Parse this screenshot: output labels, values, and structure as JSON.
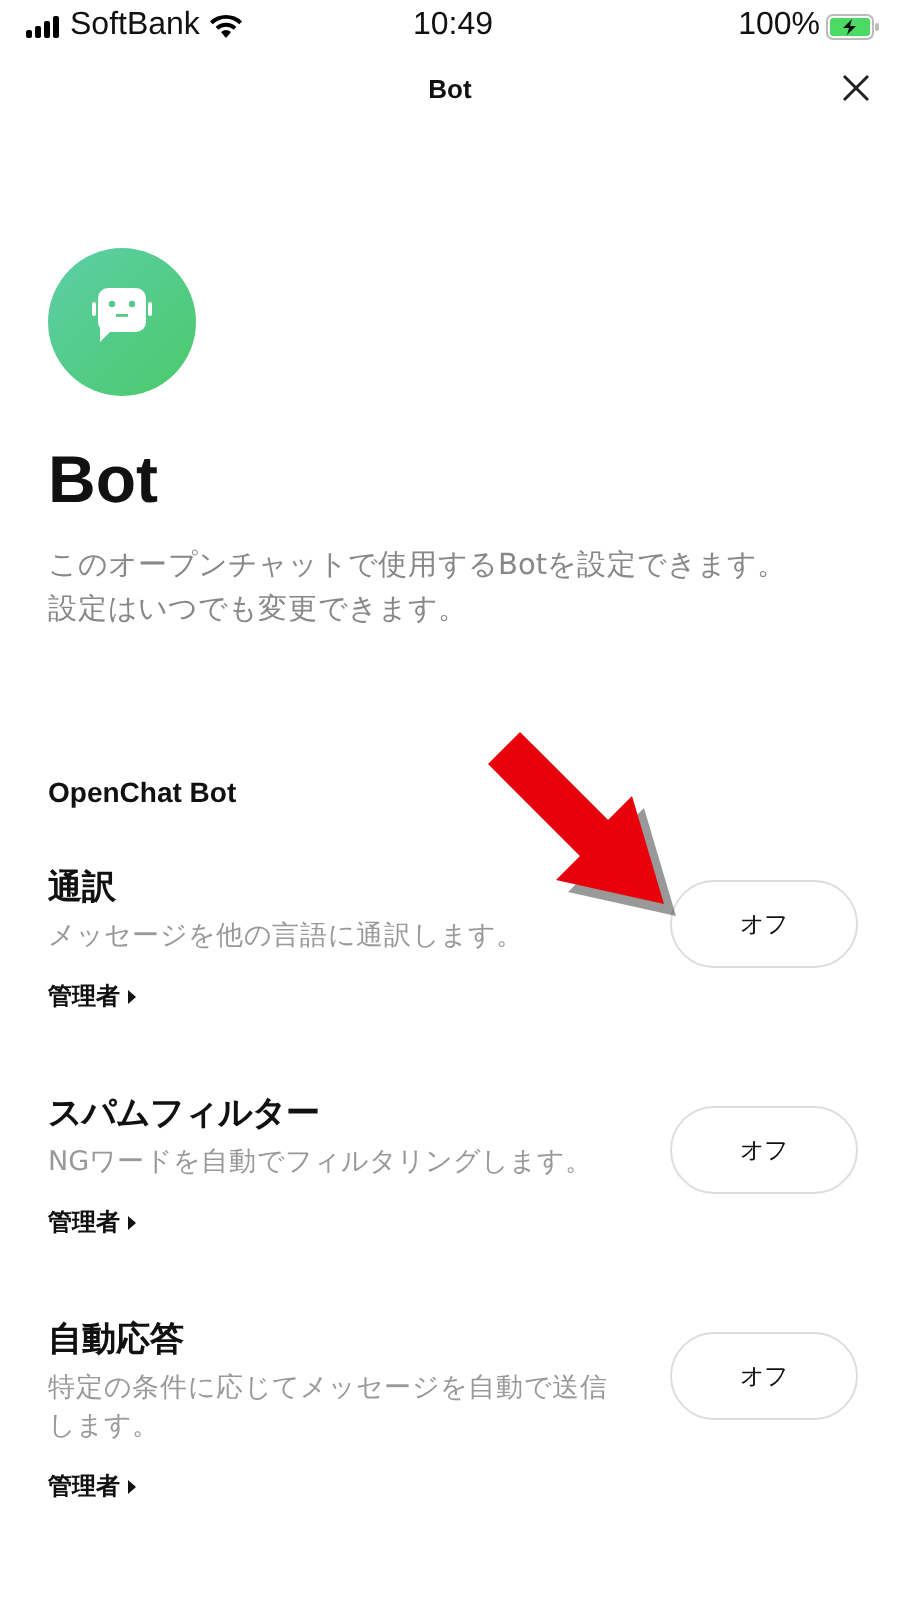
{
  "status_bar": {
    "carrier": "SoftBank",
    "time": "10:49",
    "battery": "100%"
  },
  "nav": {
    "title": "Bot"
  },
  "header": {
    "title": "Bot",
    "description": "このオープンチャットで使用するBotを設定できます。設定はいつでも変更できます。"
  },
  "section": {
    "title": "OpenChat Bot"
  },
  "bots": [
    {
      "name": "通訳",
      "description": "メッセージを他の言語に通訳します。",
      "permission": "管理者",
      "toggle": "オフ",
      "on": false
    },
    {
      "name": "スパムフィルター",
      "description": "NGワードを自動でフィルタリングします。",
      "permission": "管理者",
      "toggle": "オフ",
      "on": false
    },
    {
      "name": "自動応答",
      "description": "特定の条件に応じてメッセージを自動で送信します。",
      "permission": "管理者",
      "toggle": "オフ",
      "on": false
    }
  ]
}
